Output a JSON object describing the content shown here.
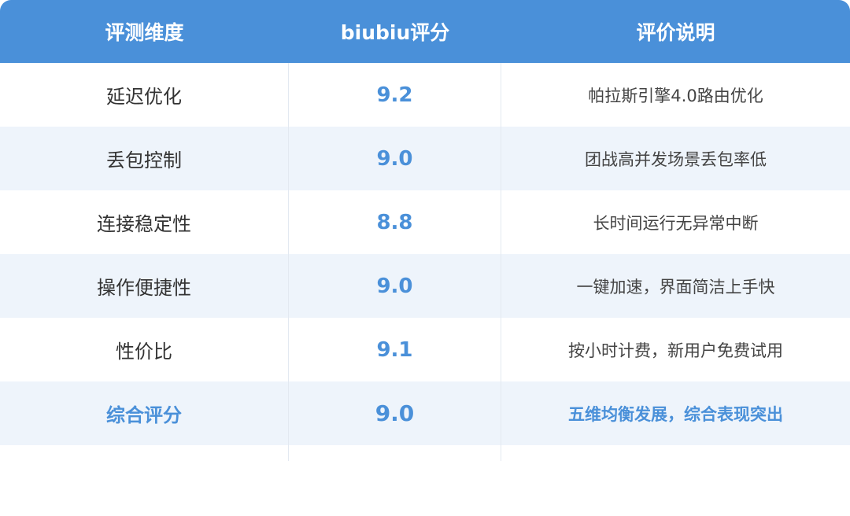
{
  "header": {
    "col1": "评测维度",
    "col2": "biubiu评分",
    "col3": "评价说明"
  },
  "rows": [
    {
      "dimension": "延迟优化",
      "score": "9.2",
      "description": "帕拉斯引擎4.0路由优化"
    },
    {
      "dimension": "丢包控制",
      "score": "9.0",
      "description": "团战高并发场景丢包率低"
    },
    {
      "dimension": "连接稳定性",
      "score": "8.8",
      "description": "长时间运行无异常中断"
    },
    {
      "dimension": "操作便捷性",
      "score": "9.0",
      "description": "一键加速，界面简洁上手快"
    },
    {
      "dimension": "性价比",
      "score": "9.1",
      "description": "按小时计费，新用户免费试用"
    }
  ],
  "total": {
    "dimension": "综合评分",
    "score": "9.0",
    "description": "五维均衡发展，综合表现突出"
  },
  "colors": {
    "header_bg": "#4a90d9",
    "accent": "#4a90d9",
    "stripe": "#eef4fb"
  }
}
